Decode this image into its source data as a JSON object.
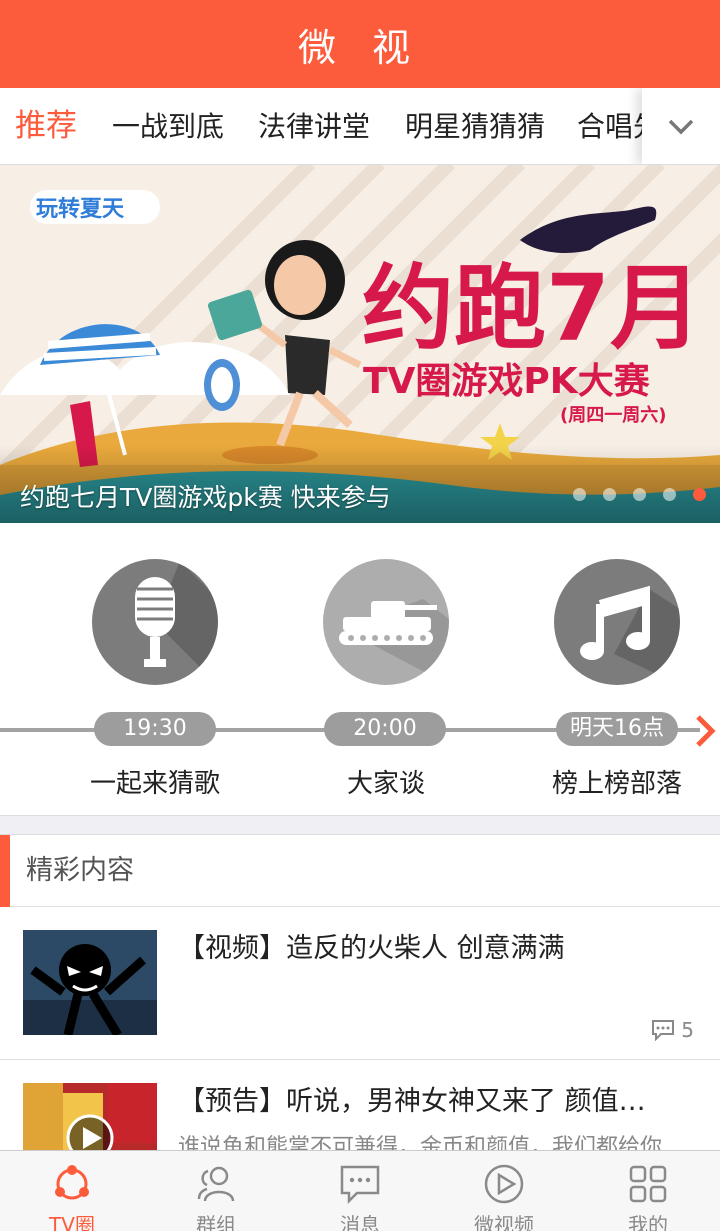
{
  "header": {
    "title": "微 视"
  },
  "tabs": {
    "items": [
      {
        "label": "推荐",
        "active": true
      },
      {
        "label": "一战到底",
        "active": false
      },
      {
        "label": "法律讲堂",
        "active": false
      },
      {
        "label": "明星猜猜猜",
        "active": false
      },
      {
        "label": "合唱先锋",
        "active": false
      }
    ],
    "more_icon": "chevron-down-icon"
  },
  "banner": {
    "caption": "约跑七月TV圈游戏pk赛 快来参与",
    "art": {
      "badge": "玩转夏天",
      "headline": "约跑7月",
      "subheadline": "TV圈游戏PK大赛",
      "schedule": "(周四一周六)"
    },
    "dots_count": 5,
    "active_dot": 5
  },
  "shows": [
    {
      "name": "一起来猜歌",
      "time": "19:30",
      "icon": "microphone-icon"
    },
    {
      "name": "大家谈",
      "time": "20:00",
      "icon": "tank-icon"
    },
    {
      "name": "榜上榜部落",
      "time": "明天16点",
      "icon": "music-note-icon"
    }
  ],
  "section": {
    "title": "精彩内容"
  },
  "articles": [
    {
      "title": "【视频】造反的火柴人 创意满满",
      "summary": "",
      "comments": "5"
    },
    {
      "title": "【预告】听说，男神女神又来了 颜值…",
      "summary": "谁说鱼和熊掌不可兼得，金币和颜值，我们都给你",
      "comments": ""
    }
  ],
  "bottom_nav": [
    {
      "label": "TV圈",
      "icon": "tv-circle-icon",
      "active": true
    },
    {
      "label": "群组",
      "icon": "group-icon",
      "active": false
    },
    {
      "label": "消息",
      "icon": "message-icon",
      "active": false
    },
    {
      "label": "微视频",
      "icon": "play-icon",
      "active": false
    },
    {
      "label": "我的",
      "icon": "grid-icon",
      "active": false
    }
  ],
  "colors": {
    "accent": "#fd5c3c",
    "banner_headline": "#d6194a",
    "banner_bg": "#f7efe6"
  }
}
